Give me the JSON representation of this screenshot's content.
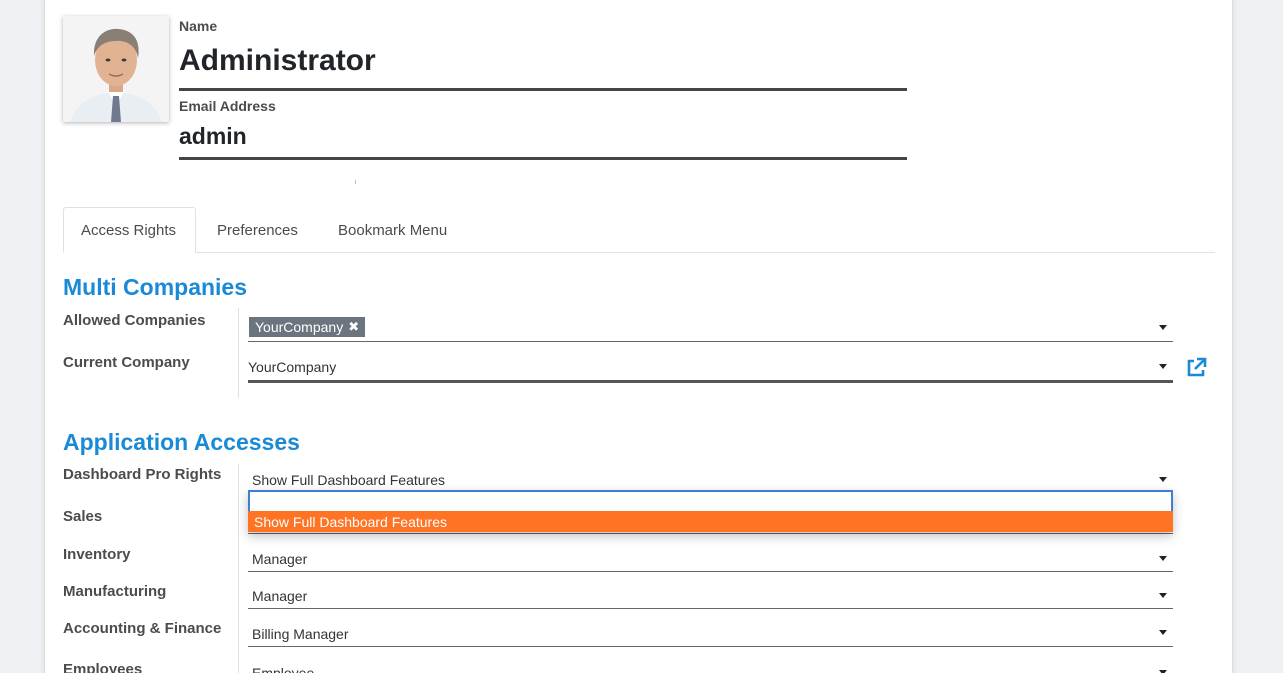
{
  "header": {
    "name_label": "Name",
    "name_value": "Administrator",
    "email_label": "Email Address",
    "email_value": "admin"
  },
  "tabs": [
    {
      "label": "Access Rights",
      "active": true
    },
    {
      "label": "Preferences",
      "active": false
    },
    {
      "label": "Bookmark Menu",
      "active": false
    }
  ],
  "multi_companies": {
    "title": "Multi Companies",
    "allowed_label": "Allowed Companies",
    "allowed_tags": [
      "YourCompany"
    ],
    "current_label": "Current Company",
    "current_value": "YourCompany"
  },
  "app_access": {
    "title": "Application Accesses",
    "rows": [
      {
        "label": "Dashboard Pro Rights",
        "value": "Show Full Dashboard Features"
      },
      {
        "label": "Sales",
        "value": ""
      },
      {
        "label": "Inventory",
        "value": "Manager"
      },
      {
        "label": "Manufacturing",
        "value": "Manager"
      },
      {
        "label": "Accounting & Finance",
        "value": "Billing Manager"
      },
      {
        "label": "Employees",
        "value": "Employee"
      }
    ],
    "dropdown_option": "Show Full Dashboard Features"
  },
  "colors": {
    "accent_blue": "#1a8ad6",
    "dropdown_highlight": "#ff7324",
    "tag_bg": "#6c757d"
  }
}
